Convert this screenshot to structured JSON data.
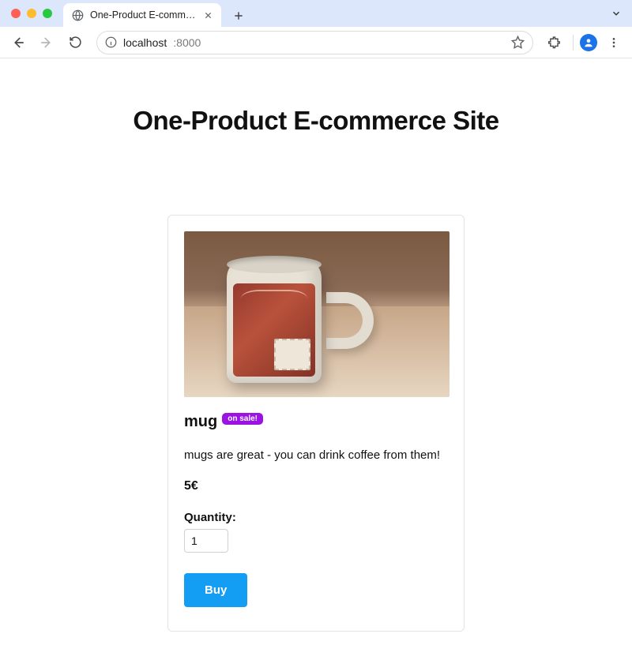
{
  "browser": {
    "tab_title": "One-Product E-commerce Sit",
    "url_host": "localhost",
    "url_port": ":8000"
  },
  "page": {
    "heading": "One-Product E-commerce Site"
  },
  "product": {
    "name": "mug",
    "sale_badge": "on sale!",
    "description": "mugs are great - you can drink coffee from them!",
    "price": "5€",
    "quantity_label": "Quantity:",
    "quantity_value": "1",
    "buy_label": "Buy"
  }
}
